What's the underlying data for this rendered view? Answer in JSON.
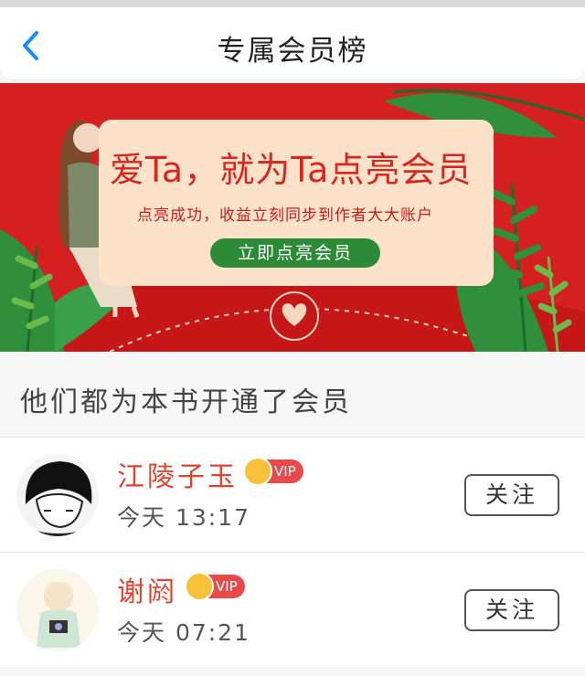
{
  "header": {
    "title": "专属会员榜",
    "back_icon": "chevron-left-icon",
    "accent": "#1a8cff"
  },
  "banner": {
    "headline": "爱Ta，就为Ta点亮会员",
    "subtitle": "点亮成功，收益立刻同步到作者大大账户",
    "cta_label": "立即点亮会员",
    "colors": {
      "background": "#d42020",
      "card": "#fbe2c8",
      "cta": "#2d8b38"
    }
  },
  "section": {
    "title": "他们都为本书开通了会员"
  },
  "members": [
    {
      "name": "江陵子玉",
      "vip_label": "VIP",
      "time": "今天 13:17",
      "follow_label": "关注"
    },
    {
      "name": "谢阏",
      "vip_label": "VIP",
      "time": "今天 07:21",
      "follow_label": "关注"
    }
  ]
}
